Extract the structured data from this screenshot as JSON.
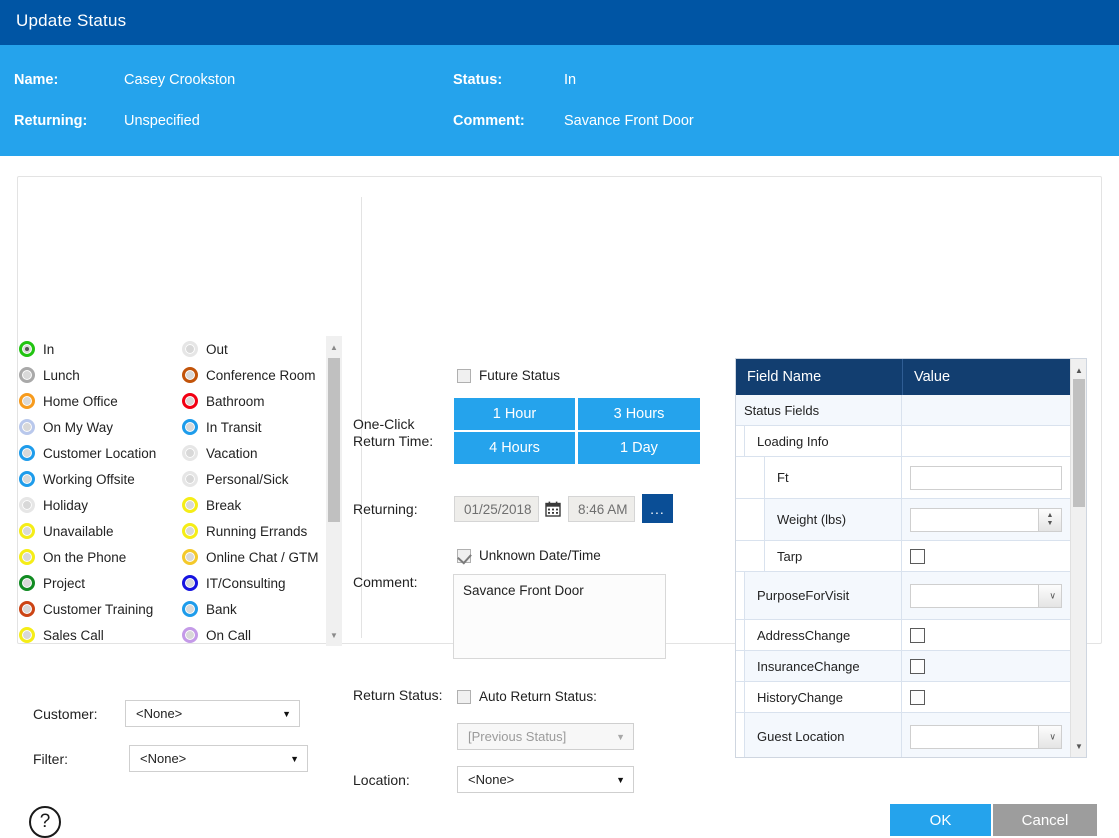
{
  "window": {
    "title": "Update Status"
  },
  "info": {
    "name_label": "Name:",
    "name_value": "Casey Crookston",
    "returning_label": "Returning:",
    "returning_value": "Unspecified",
    "status_label": "Status:",
    "status_value": "In",
    "comment_label": "Comment:",
    "comment_value": "Savance Front Door"
  },
  "status_list": {
    "selected": "In",
    "left_column": [
      {
        "label": "In",
        "color": "#22c412",
        "selected": true
      },
      {
        "label": "Lunch",
        "color": "#a9a9a9",
        "selected": false
      },
      {
        "label": "Home Office",
        "color": "#f79b1d",
        "selected": false
      },
      {
        "label": "On My Way",
        "color": "#b9c8ec",
        "selected": false
      },
      {
        "label": "Customer Location",
        "color": "#1e9ceb",
        "selected": false
      },
      {
        "label": "Working Offsite",
        "color": "#1e9ceb",
        "selected": false
      },
      {
        "label": "Holiday",
        "color": "#e6e6e6",
        "selected": false
      },
      {
        "label": "Unavailable",
        "color": "#f5ed17",
        "selected": false
      },
      {
        "label": "On the Phone",
        "color": "#f5ed17",
        "selected": false
      },
      {
        "label": "Project",
        "color": "#118b22",
        "selected": false
      },
      {
        "label": "Customer Training",
        "color": "#cc4415",
        "selected": false
      },
      {
        "label": "Sales Call",
        "color": "#f5ed17",
        "selected": false
      }
    ],
    "right_column": [
      {
        "label": "Out",
        "color": "#e6e6e6",
        "selected": false
      },
      {
        "label": "Conference Room",
        "color": "#c2540a",
        "selected": false
      },
      {
        "label": "Bathroom",
        "color": "#f20013",
        "selected": false
      },
      {
        "label": "In Transit",
        "color": "#1e9ceb",
        "selected": false
      },
      {
        "label": "Vacation",
        "color": "#e6e6e6",
        "selected": false
      },
      {
        "label": "Personal/Sick",
        "color": "#e6e6e6",
        "selected": false
      },
      {
        "label": "Break",
        "color": "#f5ed17",
        "selected": false
      },
      {
        "label": "Running Errands",
        "color": "#f5ed17",
        "selected": false
      },
      {
        "label": "Online Chat / GTM",
        "color": "#f4c92b",
        "selected": false
      },
      {
        "label": "IT/Consulting",
        "color": "#1613e0",
        "selected": false
      },
      {
        "label": "Bank",
        "color": "#1e9ceb",
        "selected": false
      },
      {
        "label": "On Call",
        "color": "#c49ae8",
        "selected": false
      }
    ]
  },
  "left_fields": {
    "customer_label": "Customer:",
    "customer_value": "<None>",
    "filter_label": "Filter:",
    "filter_value": "<None>"
  },
  "middle": {
    "future_status_label": "Future Status",
    "future_status_checked": false,
    "one_click_label": "One-Click\nReturn Time:",
    "one_click_line1": "One-Click",
    "one_click_line2": "Return Time:",
    "quick_buttons": [
      "1 Hour",
      "3 Hours",
      "4 Hours",
      "1 Day"
    ],
    "returning_label": "Returning:",
    "returning_date": "01/25/2018",
    "returning_time": "8:46 AM",
    "calendar_icon": "calendar-icon",
    "ellipsis_label": "...",
    "unknown_label": "Unknown Date/Time",
    "unknown_checked": true,
    "comment_label": "Comment:",
    "comment_value": "Savance Front Door",
    "return_status_label": "Return Status:",
    "auto_return_label": "Auto Return Status:",
    "auto_return_checked": false,
    "previous_status_value": "[Previous Status]",
    "location_label": "Location:",
    "location_value": "<None>"
  },
  "table": {
    "headers": [
      "Field Name",
      "Value"
    ],
    "rows": [
      {
        "name": "Status Fields",
        "indent": 0,
        "control": "none",
        "value": "",
        "alt": true
      },
      {
        "name": "Loading Info",
        "indent": 1,
        "control": "none",
        "value": "",
        "alt": false
      },
      {
        "name": "Ft",
        "indent": 2,
        "control": "text",
        "value": "",
        "alt": false
      },
      {
        "name": "Weight (lbs)",
        "indent": 2,
        "control": "spinner",
        "value": "",
        "alt": true
      },
      {
        "name": "Tarp",
        "indent": 2,
        "control": "checkbox",
        "value": "",
        "alt": false
      },
      {
        "name": "PurposeForVisit",
        "indent": 1,
        "control": "dropdown",
        "value": "",
        "alt": true
      },
      {
        "name": "AddressChange",
        "indent": 1,
        "control": "checkbox",
        "value": "",
        "alt": false
      },
      {
        "name": "InsuranceChange",
        "indent": 1,
        "control": "checkbox",
        "value": "",
        "alt": true
      },
      {
        "name": "HistoryChange",
        "indent": 1,
        "control": "checkbox",
        "value": "",
        "alt": false
      },
      {
        "name": "Guest Location",
        "indent": 1,
        "control": "dropdown",
        "value": "",
        "alt": true
      }
    ]
  },
  "footer": {
    "help_label": "?",
    "ok_label": "OK",
    "cancel_label": "Cancel"
  },
  "colors": {
    "titlebar": "#0055a4",
    "infoband": "#25a3ec",
    "accent": "#25a3ec",
    "table_header": "#123e70",
    "cancel": "#9d9d9d"
  }
}
